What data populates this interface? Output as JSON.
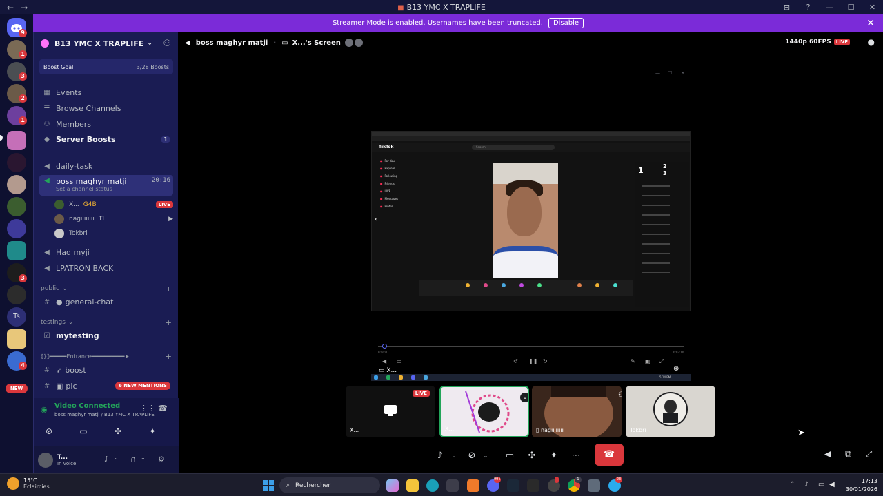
{
  "window": {
    "title": "B13 YMC X TRAPLIFE",
    "back": "←",
    "forward": "→",
    "controls": [
      "—",
      "☐",
      "✕"
    ]
  },
  "streamer_bar": {
    "message": "Streamer Mode is enabled. Usernames have been truncated.",
    "disable_label": "Disable"
  },
  "rail": {
    "badges": [
      "9",
      "1",
      "3",
      "2",
      "1",
      "3",
      "4"
    ],
    "new_label": "NEW",
    "text_server": "Ts"
  },
  "guild": {
    "name": "B13 YMC X TRAPLIFE",
    "boost_goal_label": "Boost Goal",
    "boost_count": "3/28 Boosts"
  },
  "menu": {
    "events": "Events",
    "browse_channels": "Browse Channels",
    "members": "Members",
    "server_boosts": "Server Boosts",
    "server_boosts_count": "1"
  },
  "channels": {
    "daily_task": "daily-task",
    "boss": "boss maghyr matji",
    "boss_time": "20:16",
    "boss_status": "Set a channel status",
    "voice_users": [
      {
        "name": "X...",
        "tag": "G4B",
        "live": "LIVE"
      },
      {
        "name": "nagiiiiiiii",
        "tag": "TL"
      },
      {
        "name": "Tokbri"
      }
    ],
    "had_myji": "Had myji",
    "lpatron": "LPATRON BACK",
    "cat_public": "public",
    "general_chat": "general-chat",
    "cat_testings": "testings",
    "mytesting": "mytesting",
    "cat_entrance": "⟫⟫⟫━━━━━Entrance━━━━━━━━━━➤",
    "boost": "boost",
    "pic_partial": "pic",
    "new_mentions": "6 NEW MENTIONS"
  },
  "voice_panel": {
    "status": "Video Connected",
    "location": "boss maghyr matji / B13 YMC X TRAPLIFE"
  },
  "user_panel": {
    "name": "T...",
    "status": "In voice"
  },
  "stage": {
    "channel": "boss maghyr matji",
    "screen_title": "X...'s Screen",
    "quality": "1440p 60FPS",
    "live": "LIVE",
    "screen_label": "X..."
  },
  "shared_screen": {
    "app_name": "TikTok",
    "search_placeholder": "Search",
    "nav": [
      "For You",
      "Explore",
      "Following",
      "Friends",
      "LIVE",
      "Messages",
      "Profile"
    ],
    "ranks": [
      "1",
      "2",
      "3"
    ],
    "time_start": "0:00:07",
    "time_end": "0:02:10",
    "clock": "5:14 PM"
  },
  "tiles": [
    {
      "label": "X...",
      "live": "LIVE"
    },
    {
      "label": "X..."
    },
    {
      "label": "nagiiiiiiii"
    },
    {
      "label": "Tokbri"
    }
  ],
  "taskbar": {
    "temperature": "15°C",
    "condition": "Eclaircies",
    "search_placeholder": "Rechercher",
    "badges": [
      "99+",
      "1",
      "23"
    ],
    "time": "17:13",
    "date": "30/01/2026"
  },
  "colors": {
    "accent": "#5865f2",
    "danger": "#da373c",
    "streamer_bar": "#7b2bd8",
    "sidebar": "#1a1c53",
    "online": "#23a55a"
  }
}
